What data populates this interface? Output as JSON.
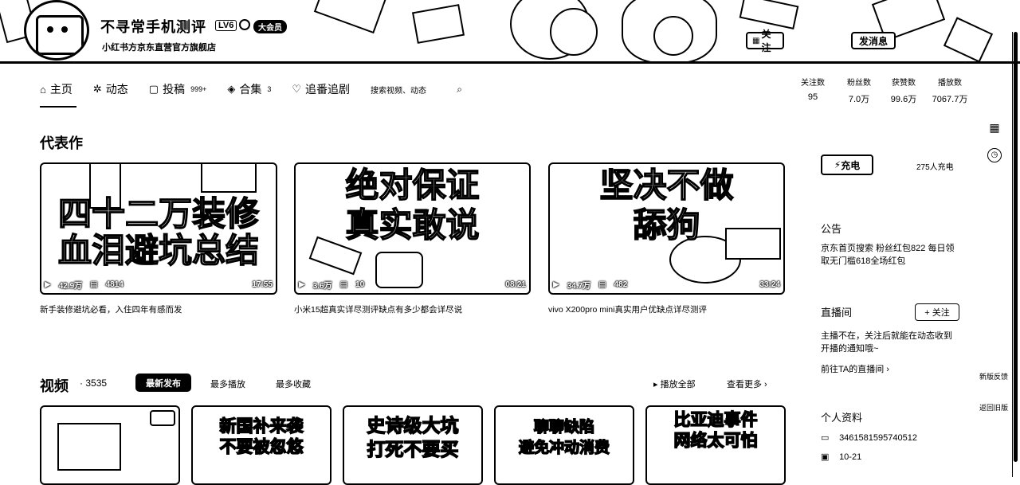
{
  "header": {
    "username": "不寻常手机测评",
    "level": "LV6",
    "vip_badge": "大会员",
    "sign": "小红书方京东直营官方旗舰店",
    "follow_label": "关注",
    "message_label": "发消息"
  },
  "nav": {
    "items": [
      {
        "icon": "home-icon",
        "glyph": "⌂",
        "label": "主页",
        "count": ""
      },
      {
        "icon": "dynamic-icon",
        "glyph": "✲",
        "label": "动态",
        "count": ""
      },
      {
        "icon": "upload-icon",
        "glyph": "▢",
        "label": "投稿",
        "count": "999+"
      },
      {
        "icon": "collection-icon",
        "glyph": "◈",
        "label": "合集",
        "count": "3"
      },
      {
        "icon": "heart-icon",
        "glyph": "♡",
        "label": "追番追剧",
        "count": ""
      }
    ],
    "search_placeholder": "搜索视频、动态"
  },
  "stats": [
    {
      "label": "关注数",
      "value": "95"
    },
    {
      "label": "粉丝数",
      "value": "7.0万"
    },
    {
      "label": "获赞数",
      "value": "99.6万"
    },
    {
      "label": "播放数",
      "value": "7067.7万"
    }
  ],
  "featured": {
    "title": "代表作",
    "videos": [
      {
        "cover_line1": "四十二万装修",
        "cover_line2": "血泪避坑总结",
        "views": "42.9万",
        "danmaku": "4814",
        "duration": "17:55",
        "title": "新手装修避坑必看，入住四年有感而发"
      },
      {
        "cover_line1": "绝对保证",
        "cover_line2": "真实敢说",
        "views": "3.6万",
        "danmaku": "10",
        "duration": "08:21",
        "title": "小米15超真实详尽测评缺点有多少都会详尽说"
      },
      {
        "cover_line1": "坚决不做",
        "cover_line2": "舔狗",
        "views": "34.7万",
        "danmaku": "482",
        "duration": "33:24",
        "title": "vivo X200pro mini真实用户优缺点详尽测评"
      }
    ]
  },
  "videos": {
    "title": "视频",
    "count": "3535",
    "tabs": [
      "最新发布",
      "最多播放",
      "最多收藏"
    ],
    "play_all": "播放全部",
    "more": "查看更多",
    "covers": [
      {
        "text1": "",
        "text2": ""
      },
      {
        "text1": "新国补来袭",
        "text2": "不要被忽悠"
      },
      {
        "text1": "史诗级大坑",
        "text2": "打死不要买"
      },
      {
        "text1": "聊聊缺陷",
        "text2": "避免冲动消费"
      },
      {
        "text1": "比亚迪事件",
        "text2": "网络太可怕"
      }
    ]
  },
  "right": {
    "charge_label": "充电",
    "charge_count": "275人充电",
    "notice_title": "公告",
    "notice_text": "京东首页搜索 粉丝红包822 每日领取无门槛618全场红包",
    "live_title": "直播间",
    "live_follow": "+ 关注",
    "live_text": "主播不在，关注后就能在动态收到开播的通知哦~",
    "live_link": "前往TA的直播间",
    "profile_title": "个人资料",
    "uid": "3461581595740512",
    "birthday": "10-21"
  },
  "side": {
    "new_feedback": "新版反馈",
    "back_old": "返回旧版"
  }
}
